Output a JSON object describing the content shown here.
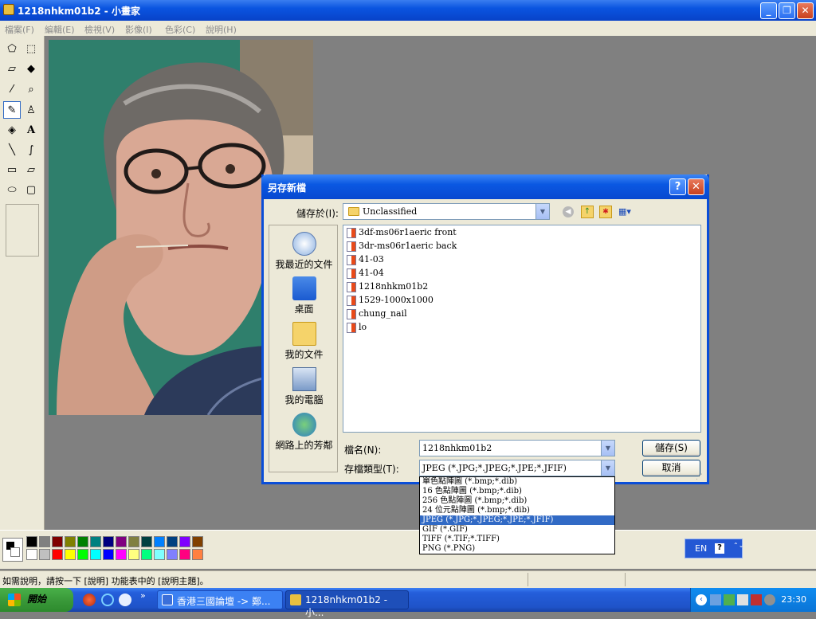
{
  "window": {
    "title": "1218nhkm01b2 - 小畫家",
    "minimize": "_",
    "maximize": "❐",
    "close": "✕"
  },
  "menu": [
    "檔案(F)",
    "編輯(E)",
    "檢視(V)",
    "影像(I)",
    "色彩(C)",
    "說明(H)"
  ],
  "tools": [
    "free-select",
    "rect-select",
    "eraser",
    "fill",
    "picker",
    "magnifier",
    "pencil",
    "brush",
    "airbrush",
    "text",
    "line",
    "curve",
    "rectangle",
    "polygon",
    "ellipse",
    "rounded-rect"
  ],
  "palette": {
    "top": [
      "#000000",
      "#808080",
      "#800000",
      "#808000",
      "#008000",
      "#008080",
      "#000080",
      "#800080",
      "#808040",
      "#004040",
      "#0080ff",
      "#004080",
      "#8000ff",
      "#804000"
    ],
    "bottom": [
      "#ffffff",
      "#c0c0c0",
      "#ff0000",
      "#ffff00",
      "#00ff00",
      "#00ffff",
      "#0000ff",
      "#ff00ff",
      "#ffff80",
      "#00ff80",
      "#80ffff",
      "#8080ff",
      "#ff0080",
      "#ff8040"
    ]
  },
  "status": {
    "help": "如需說明，請按一下 [說明] 功能表中的 [說明主題]。"
  },
  "taskbar": {
    "start": "開始",
    "items": [
      "香港三國論壇 -> 鄭...",
      "1218nhkm01b2 - 小..."
    ],
    "clock": "23:30",
    "lang": "EN"
  },
  "dialog": {
    "title": "另存新檔",
    "help_btn": "?",
    "close_btn": "✕",
    "lookin_label": "儲存於(I):",
    "lookin_value": "Unclassified",
    "places": [
      "我最近的文件",
      "桌面",
      "我的文件",
      "我的電腦",
      "網路上的芳鄰"
    ],
    "files": [
      "3df-ms06r1aeric front",
      "3dr-ms06r1aeric back",
      "41-03",
      "41-04",
      "1218nhkm01b2",
      "1529-1000x1000",
      "chung_nail",
      "lo"
    ],
    "filename_label": "檔名(N):",
    "filename_value": "1218nhkm01b2",
    "filetype_label": "存檔類型(T):",
    "filetype_value": "JPEG (*.JPG;*.JPEG;*.JPE;*.JFIF)",
    "save_btn": "儲存(S)",
    "cancel_btn": "取消",
    "type_options": [
      "單色點陣圖 (*.bmp;*.dib)",
      "16 色點陣圖 (*.bmp;*.dib)",
      "256 色點陣圖 (*.bmp;*.dib)",
      "24 位元點陣圖 (*.bmp;*.dib)",
      "JPEG (*.JPG;*.JPEG;*.JPE;*.JFIF)",
      "GIF (*.GIF)",
      "TIFF (*.TIF;*.TIFF)",
      "PNG (*.PNG)"
    ],
    "selected_type_index": 4
  }
}
